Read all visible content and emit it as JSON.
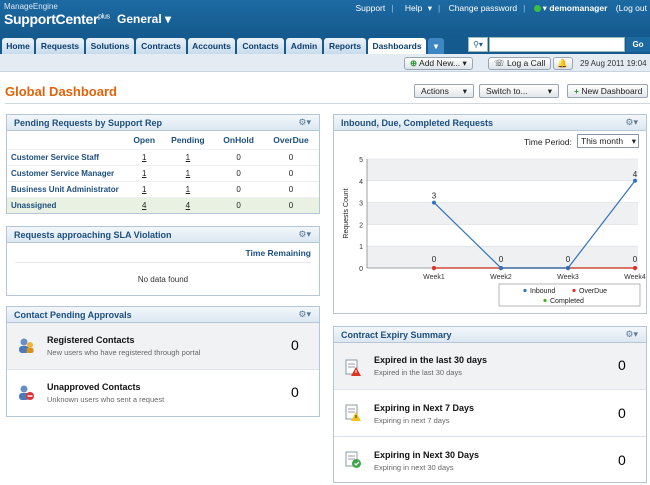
{
  "header": {
    "brand_small": "ManageEngine",
    "brand_main": "SupportCenter",
    "brand_sup": "plus",
    "context": "General",
    "links": {
      "support": "Support",
      "help": "Help",
      "change_password": "Change password",
      "user": "demomanager",
      "logout": "(Log out"
    }
  },
  "tabs": [
    "Home",
    "Requests",
    "Solutions",
    "Contracts",
    "Accounts",
    "Contacts",
    "Admin",
    "Reports",
    "Dashboards"
  ],
  "search": {
    "placeholder": "",
    "go": "Go"
  },
  "actionbar": {
    "add_new": "Add New...",
    "log_call": "Log a Call",
    "datetime": "29 Aug 2011 19:04"
  },
  "page": {
    "title": "Global Dashboard",
    "actions": "Actions",
    "switch_to": "Switch to...",
    "new_dashboard": "New Dashboard"
  },
  "pending": {
    "title": "Pending Requests by Support Rep",
    "columns": [
      "",
      "Open",
      "Pending",
      "OnHold",
      "OverDue"
    ],
    "rows": [
      {
        "name": "Customer Service Staff",
        "open": "1",
        "pending": "1",
        "onhold": "0",
        "overdue": "0"
      },
      {
        "name": "Customer Service Manager",
        "open": "1",
        "pending": "1",
        "onhold": "0",
        "overdue": "0"
      },
      {
        "name": "Business Unit Administrator",
        "open": "1",
        "pending": "1",
        "onhold": "0",
        "overdue": "0"
      },
      {
        "name": "Unassigned",
        "open": "4",
        "pending": "4",
        "onhold": "0",
        "overdue": "0"
      }
    ]
  },
  "sla": {
    "title": "Requests approaching SLA Violation",
    "column": "Time Remaining",
    "empty": "No data found"
  },
  "contacts": {
    "title": "Contact Pending Approvals",
    "items": [
      {
        "title": "Registered Contacts",
        "sub": "New users who have registered through portal",
        "value": "0"
      },
      {
        "title": "Unapproved Contacts",
        "sub": "Unknown users who sent a request",
        "value": "0"
      }
    ]
  },
  "inbound": {
    "title": "Inbound, Due, Completed Requests",
    "period_label": "Time Period:",
    "period_value": "This month"
  },
  "chart_data": {
    "type": "line",
    "categories": [
      "Week1",
      "Week2",
      "Week3",
      "Week4"
    ],
    "series": [
      {
        "name": "Inbound",
        "color": "#2f73c0",
        "values": [
          3,
          0,
          0,
          4
        ]
      },
      {
        "name": "OverDue",
        "color": "#e03030",
        "values": [
          0,
          0,
          0,
          0
        ]
      },
      {
        "name": "Completed",
        "color": "#4caf2a",
        "values": [
          0,
          0,
          0,
          0
        ]
      }
    ],
    "title": "",
    "xlabel": "",
    "ylabel": "Requests Count",
    "yticks": [
      "0",
      "1",
      "2",
      "3",
      "4",
      "5"
    ],
    "ylim": [
      0,
      5
    ],
    "legend": "bottom",
    "point_labels": [
      "3",
      "0",
      "0",
      "4"
    ],
    "zero_labels": [
      "0",
      "0",
      "0",
      "0"
    ]
  },
  "expiry": {
    "title": "Contract Expiry Summary",
    "items": [
      {
        "title": "Expired in the last 30 days",
        "sub": "Expired in the last 30 days",
        "value": "0"
      },
      {
        "title": "Expiring in Next 7 Days",
        "sub": "Expiring in next 7 days",
        "value": "0"
      },
      {
        "title": "Expiring in Next 30 Days",
        "sub": "Expiring in next 30 days",
        "value": "0"
      }
    ]
  }
}
